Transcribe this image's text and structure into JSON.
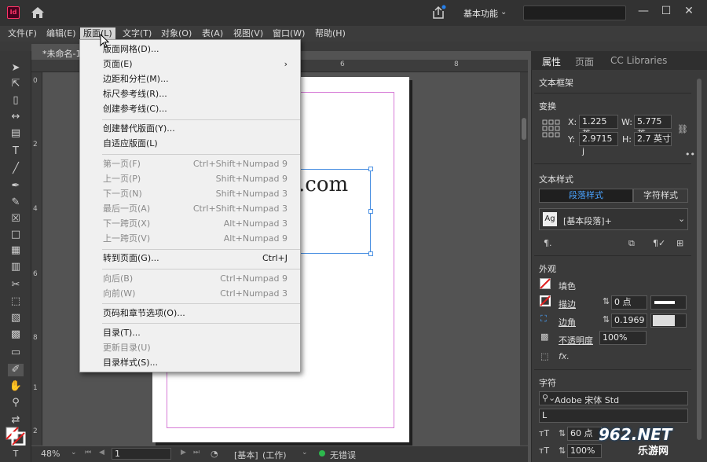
{
  "app": {
    "logo": "Id",
    "workspace": "基本功能",
    "doc_tab": "*未命名-1"
  },
  "menubar": [
    "文件(F)",
    "编辑(E)",
    "版面(L)",
    "文字(T)",
    "对象(O)",
    "表(A)",
    "视图(V)",
    "窗口(W)",
    "帮助(H)"
  ],
  "dropdown": {
    "items": [
      {
        "label": "版面网格(D)...",
        "shortcut": "",
        "disabled": false
      },
      {
        "label": "页面(E)",
        "shortcut": "›",
        "disabled": false
      },
      {
        "label": "边距和分栏(M)...",
        "shortcut": "",
        "disabled": false
      },
      {
        "label": "标尺参考线(R)...",
        "shortcut": "",
        "disabled": false
      },
      {
        "label": "创建参考线(C)...",
        "shortcut": "",
        "disabled": false
      },
      {
        "label": "创建替代版面(Y)...",
        "shortcut": "",
        "disabled": false
      },
      {
        "label": "自适应版面(L)",
        "shortcut": "",
        "disabled": false
      },
      {
        "label": "第一页(F)",
        "shortcut": "Ctrl+Shift+Numpad 9",
        "disabled": true
      },
      {
        "label": "上一页(P)",
        "shortcut": "Shift+Numpad 9",
        "disabled": true
      },
      {
        "label": "下一页(N)",
        "shortcut": "Shift+Numpad 3",
        "disabled": true
      },
      {
        "label": "最后一页(A)",
        "shortcut": "Ctrl+Shift+Numpad 3",
        "disabled": true
      },
      {
        "label": "下一跨页(X)",
        "shortcut": "Alt+Numpad 3",
        "disabled": true
      },
      {
        "label": "上一跨页(V)",
        "shortcut": "Alt+Numpad 9",
        "disabled": true
      },
      {
        "label": "转到页面(G)...",
        "shortcut": "Ctrl+J",
        "disabled": false
      },
      {
        "label": "向后(B)",
        "shortcut": "Ctrl+Numpad 9",
        "disabled": true
      },
      {
        "label": "向前(W)",
        "shortcut": "Ctrl+Numpad 3",
        "disabled": true
      },
      {
        "label": "页码和章节选项(O)...",
        "shortcut": "",
        "disabled": false
      },
      {
        "label": "目录(T)...",
        "shortcut": "",
        "disabled": false
      },
      {
        "label": "更新目录(U)",
        "shortcut": "",
        "disabled": true
      },
      {
        "label": "目录样式(S)...",
        "shortcut": "",
        "disabled": false
      }
    ]
  },
  "ruler": {
    "h_ticks": [
      "6",
      "8"
    ],
    "v_ticks": [
      "0",
      "2",
      "4",
      "6",
      "8",
      "1",
      "2"
    ]
  },
  "document": {
    "frame_text": ".com"
  },
  "status": {
    "zoom": "48%",
    "page": "1",
    "master": "[基本]",
    "mode": "(工作)",
    "preflight": "无错误"
  },
  "panel": {
    "tabs": [
      "属性",
      "页面",
      "CC Libraries"
    ],
    "object_type": "文本框架",
    "transform": {
      "title": "变换",
      "x_label": "X:",
      "x": "1.225 英",
      "w_label": "W:",
      "w": "5.775 英",
      "y_label": "Y:",
      "y": "2.9715 j",
      "h_label": "H:",
      "h": "2.7 英寸"
    },
    "text_style": {
      "title": "文本样式",
      "tab_para": "段落样式",
      "tab_char": "字符样式",
      "style_icon": "Ag",
      "style_name": "[基本段落]+"
    },
    "appearance": {
      "title": "外观",
      "fill": "填色",
      "stroke": "描边",
      "stroke_value": "0 点",
      "corner": "边角",
      "corner_value": "0.1969",
      "opacity": "不透明度",
      "opacity_value": "100%"
    },
    "character": {
      "title": "字符",
      "font": "Adobe 宋体 Std",
      "font_style": "L",
      "size": "60 点",
      "scale": "100%"
    }
  },
  "watermark": {
    "text": "962.NET",
    "sub": "乐游网"
  },
  "colors": {
    "accent": "#2680eb",
    "frame": "#4a90e2",
    "margin": "#d67bd6",
    "ok": "#2db84d"
  }
}
